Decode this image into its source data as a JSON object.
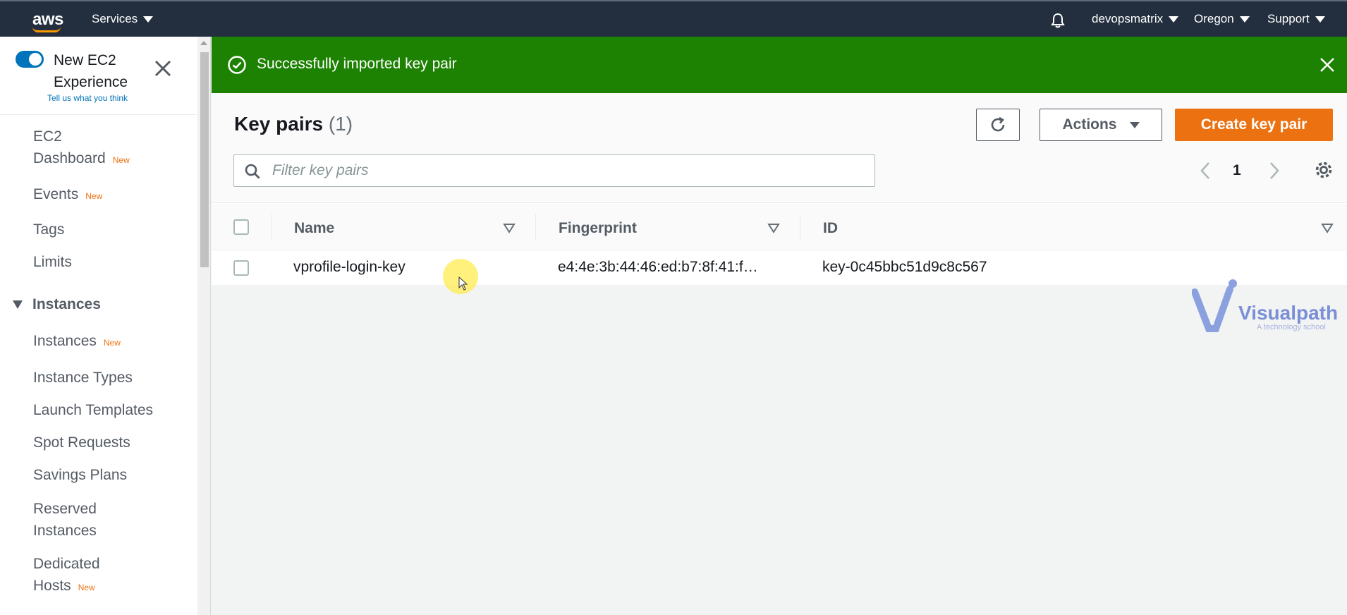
{
  "topnav": {
    "logo": "aws",
    "services_label": "Services",
    "account_label": "devopsmatrix",
    "region_label": "Oregon",
    "support_label": "Support"
  },
  "sidebar": {
    "experience_title": "New EC2 Experience",
    "experience_link": "Tell us what you think",
    "new_badge": "New",
    "items": [
      {
        "label_line1": "EC2",
        "label_line2": "Dashboard",
        "badge": "New"
      },
      {
        "label": "Events",
        "badge": "New"
      },
      {
        "label": "Tags"
      },
      {
        "label": "Limits"
      }
    ],
    "section_title": "Instances",
    "section_items": [
      {
        "label": "Instances",
        "badge": "New"
      },
      {
        "label": "Instance Types"
      },
      {
        "label": "Launch Templates"
      },
      {
        "label": "Spot Requests"
      },
      {
        "label": "Savings Plans"
      },
      {
        "label_line1": "Reserved",
        "label_line2": "Instances"
      },
      {
        "label_line1": "Dedicated",
        "label_line2": "Hosts",
        "badge": "New"
      }
    ]
  },
  "banner": {
    "message": "Successfully imported key pair",
    "color": "#1d8102"
  },
  "panel": {
    "title": "Key pairs",
    "count": "(1)",
    "actions_label": "Actions",
    "create_label": "Create key pair",
    "search_placeholder": "Filter key pairs",
    "page_number": "1"
  },
  "table": {
    "columns": [
      "Name",
      "Fingerprint",
      "ID"
    ],
    "rows": [
      {
        "name": "vprofile-login-key",
        "fingerprint": "e4:4e:3b:44:46:ed:b7:8f:41:f…",
        "id": "key-0c45bbc51d9c8c567"
      }
    ]
  },
  "watermark": {
    "name": "Visualpath",
    "tagline": "A technology school"
  },
  "colors": {
    "nav_bg": "#232f3e",
    "accent_orange": "#ec7211",
    "toggle_blue": "#0073bb",
    "success_green": "#1d8102"
  }
}
